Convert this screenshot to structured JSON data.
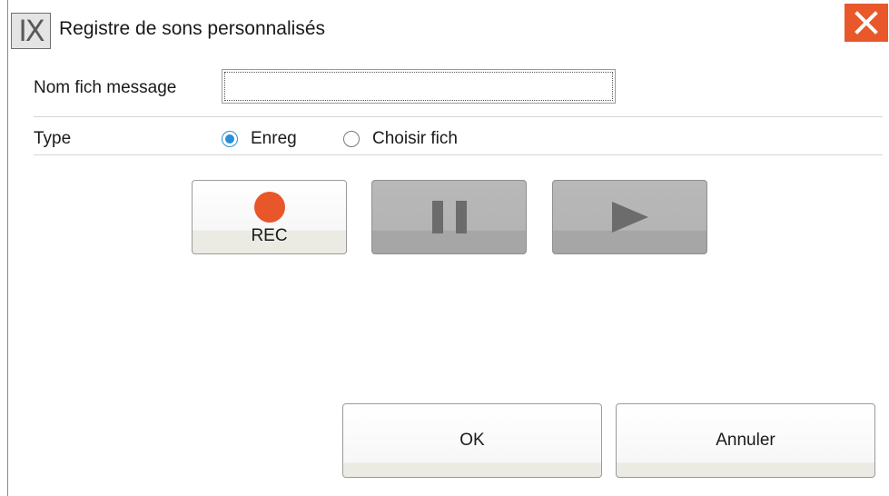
{
  "window": {
    "title": "Registre de sons personnalisés",
    "app_icon_text": "IX",
    "close_icon": "close-x-icon",
    "accent_color": "#e8582a"
  },
  "form": {
    "filename_label": "Nom fich message",
    "filename_value": "",
    "type_label": "Type",
    "type_options": [
      {
        "label": "Enreg",
        "checked": true
      },
      {
        "label": "Choisir fich",
        "checked": false
      }
    ]
  },
  "controls": {
    "rec_label": "REC",
    "rec_color": "#e8572a",
    "pause_icon": "pause-icon",
    "play_icon": "play-icon"
  },
  "actions": {
    "ok_label": "OK",
    "cancel_label": "Annuler"
  }
}
